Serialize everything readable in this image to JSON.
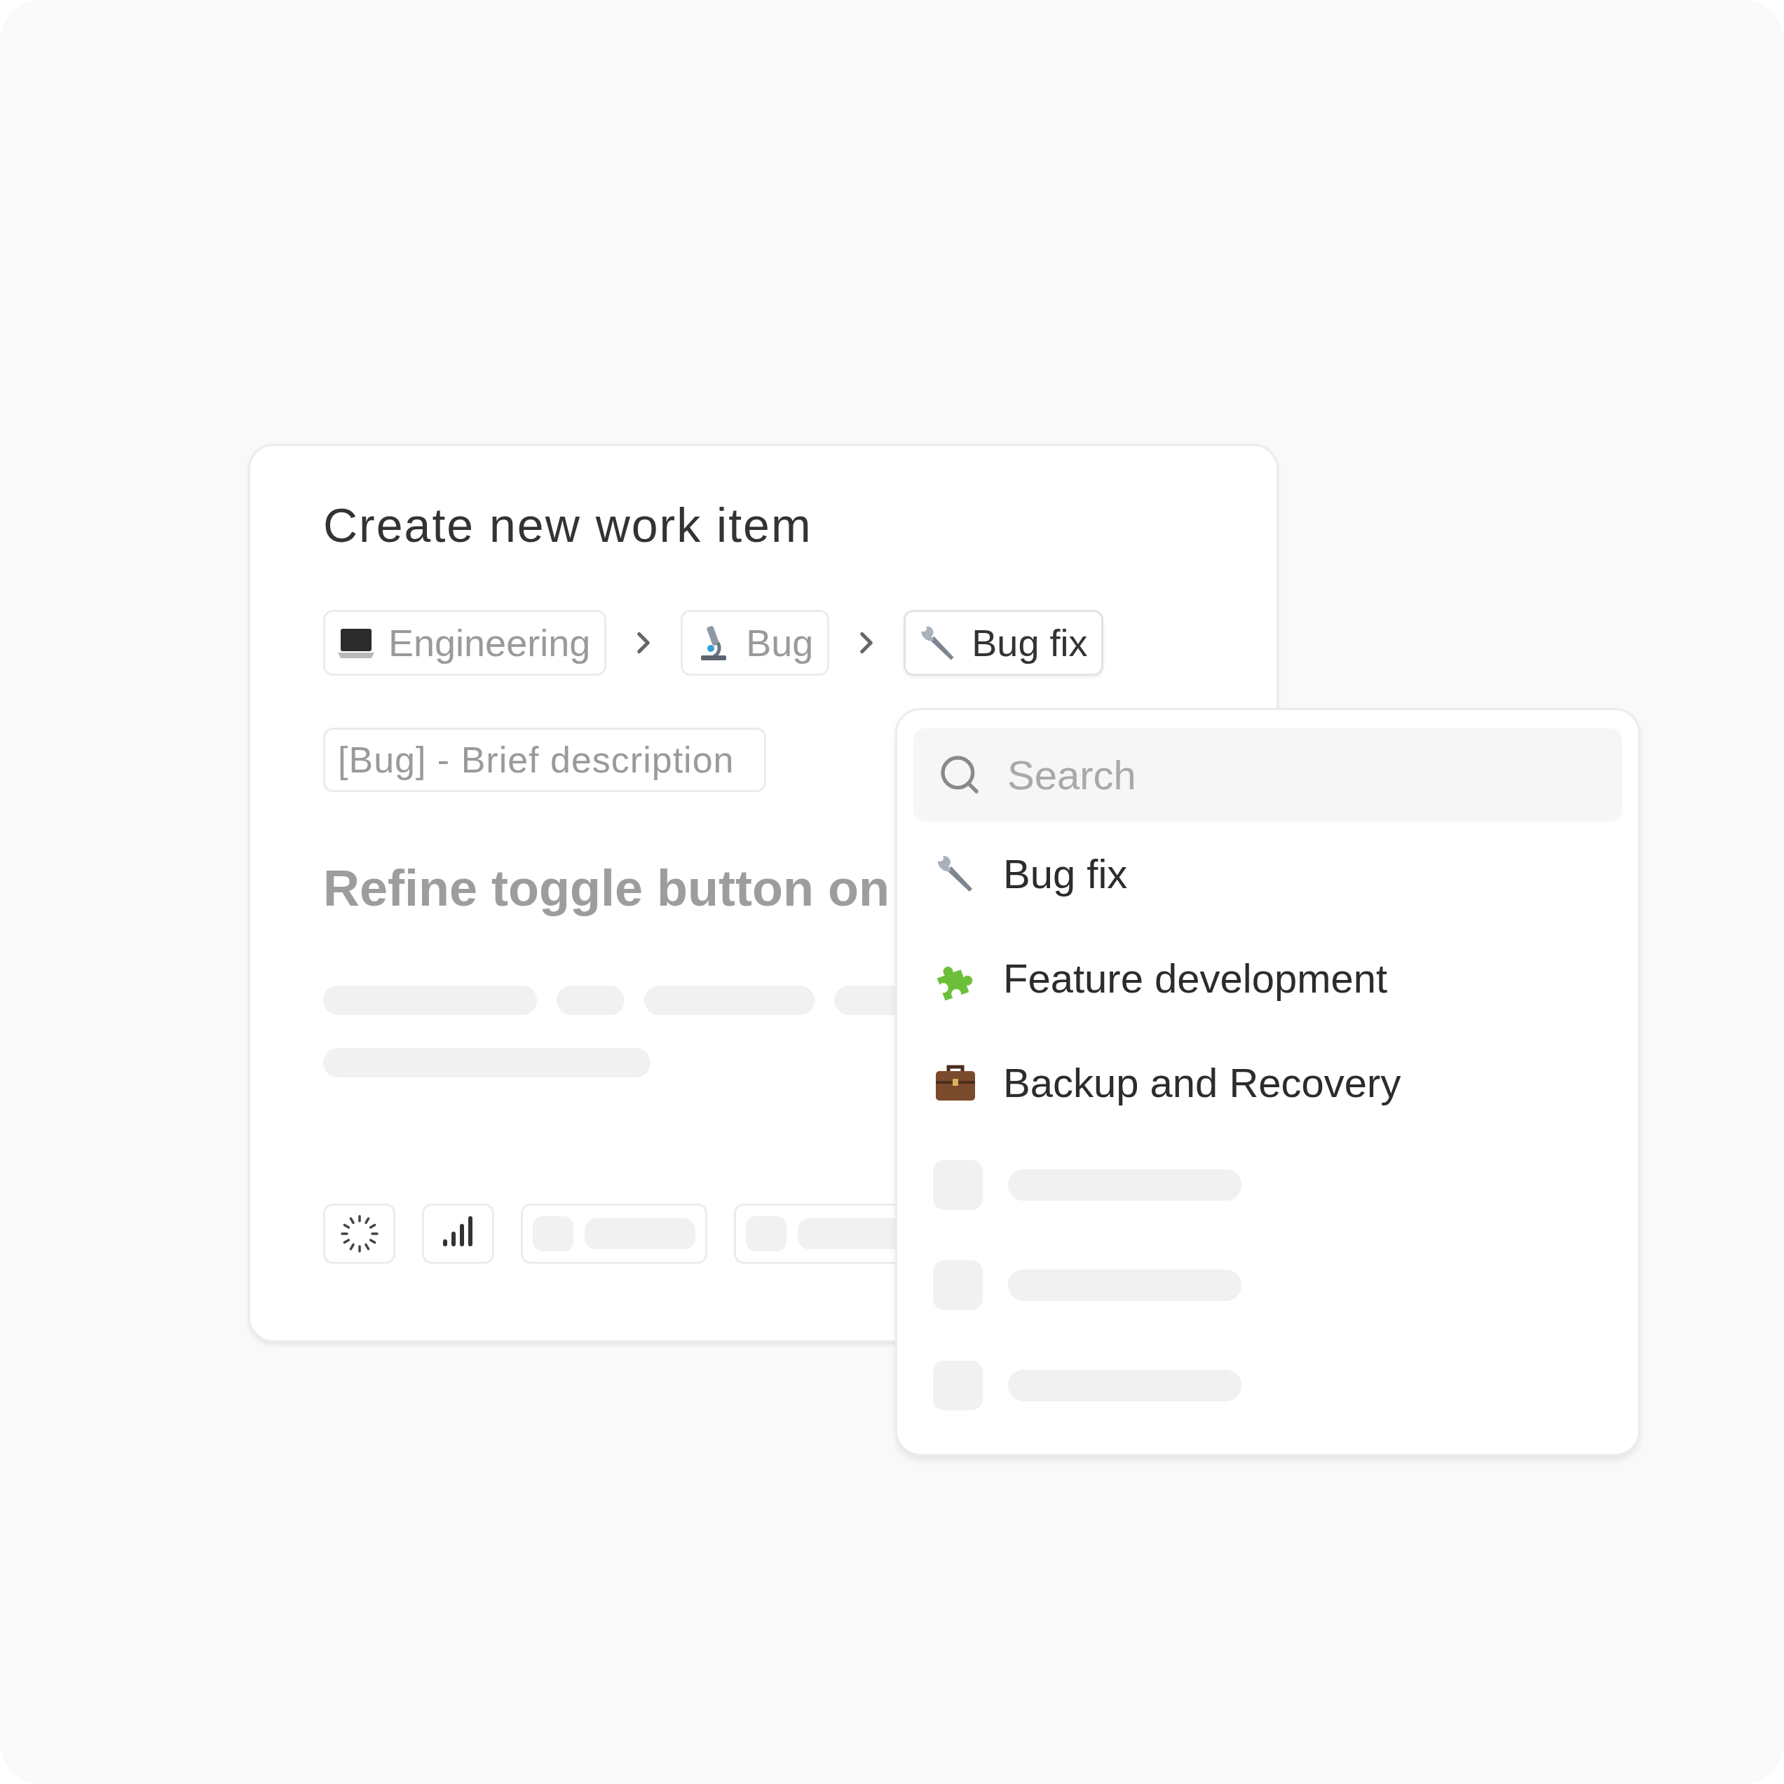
{
  "dialog": {
    "title": "Create new work item",
    "breadcrumb": [
      {
        "label": "Engineering",
        "current": false
      },
      {
        "label": "Bug",
        "current": false
      },
      {
        "label": "Bug fix",
        "current": true
      }
    ],
    "title_field": {
      "placeholder": "[Bug] - Brief description"
    },
    "heading": "Refine toggle button on"
  },
  "dropdown": {
    "search": {
      "placeholder": "Search"
    },
    "options": [
      {
        "label": "Bug fix"
      },
      {
        "label": "Feature development"
      },
      {
        "label": "Backup and Recovery"
      }
    ]
  }
}
